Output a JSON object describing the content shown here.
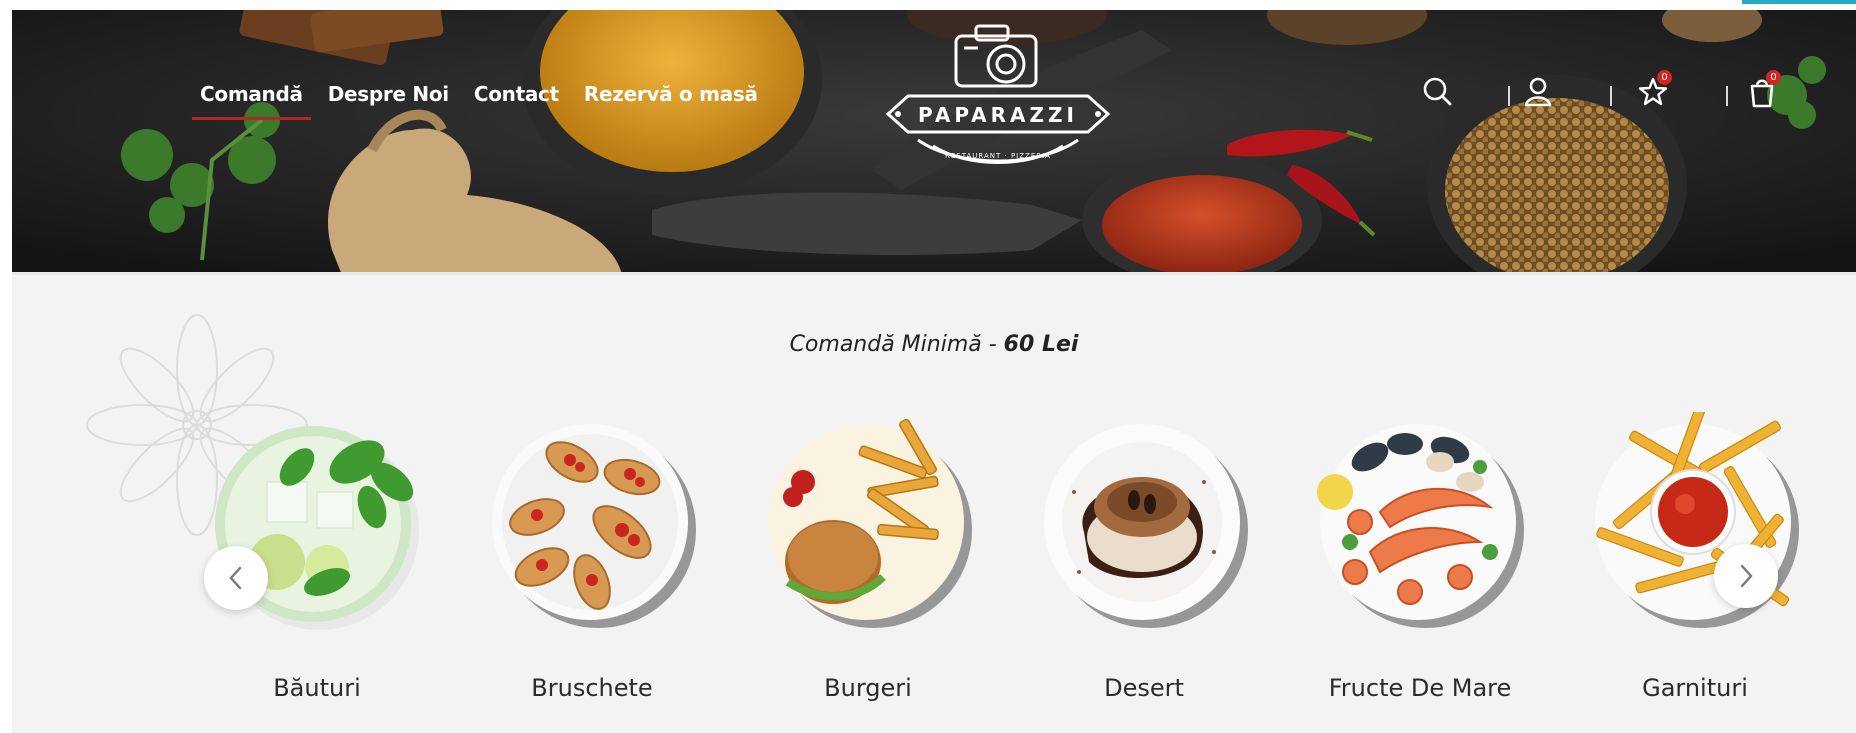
{
  "nav": {
    "items": [
      "Comandă",
      "Despre Noi",
      "Contact",
      "Rezervă o masă"
    ],
    "active_index": 0
  },
  "logo": {
    "text": "PAPARAZZI",
    "tagline": "RESTAURANT · PIZZERIA"
  },
  "header_icons": {
    "search": "search-icon",
    "account": "user-icon",
    "wishlist": "star-icon",
    "wishlist_count": "0",
    "cart": "shopping-bag-icon",
    "cart_count": "0"
  },
  "min_order": {
    "label": "Comandă Minimă - ",
    "value": "60 Lei"
  },
  "categories": [
    {
      "name": "Băuturi",
      "icon": "drink-image"
    },
    {
      "name": "Bruschete",
      "icon": "bruschetta-image"
    },
    {
      "name": "Burgeri",
      "icon": "burger-image"
    },
    {
      "name": "Desert",
      "icon": "dessert-image"
    },
    {
      "name": "Fructe De Mare",
      "icon": "seafood-image"
    },
    {
      "name": "Garnituri",
      "icon": "fries-image"
    }
  ],
  "carousel": {
    "prev_icon": "chevron-left-icon",
    "next_icon": "chevron-right-icon"
  },
  "colors": {
    "accent_red": "#b32727",
    "badge_red": "#d32525",
    "hero_bg": "#1d1d1d",
    "page_bg": "#f3f3f3"
  }
}
